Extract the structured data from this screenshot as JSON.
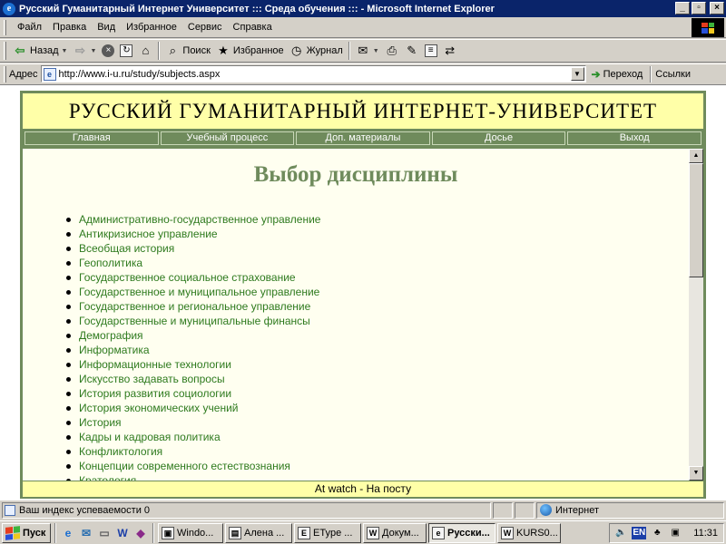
{
  "window": {
    "title": "Русский Гуманитарный Интернет Университет ::: Среда обучения ::: - Microsoft Internet Explorer",
    "buttons": {
      "minimize": "_",
      "maximize": "▫",
      "close": "×"
    }
  },
  "menu": [
    "Файл",
    "Правка",
    "Вид",
    "Избранное",
    "Сервис",
    "Справка"
  ],
  "toolbar": {
    "back_label": "Назад",
    "search_label": "Поиск",
    "favorites_label": "Избранное",
    "history_label": "Журнал"
  },
  "address": {
    "label": "Адрес",
    "url": "http://www.i-u.ru/study/subjects.aspx",
    "go_label": "Переход",
    "links_label": "Ссылки"
  },
  "site": {
    "title": "РУССКИЙ ГУМАНИТАРНЫЙ ИНТЕРНЕТ-УНИВЕРСИТЕТ",
    "nav": [
      "Главная",
      "Учебный процесс",
      "Доп. материалы",
      "Досье",
      "Выход"
    ],
    "heading": "Выбор дисциплины",
    "subjects": [
      "Административно-государственное управление",
      "Антикризисное управление",
      "Всеобщая история",
      "Геополитика",
      "Государственное социальное страхование",
      "Государственное и муниципальное управление",
      "Государственное и региональное управление",
      "Государственные и муниципальные финансы",
      "Демография",
      "Информатика",
      "Информационные технологии",
      "Искусство задавать вопросы",
      "История развития социологии",
      "История экономических учений",
      "История",
      "Кадры и кадровая политика",
      "Конфликтология",
      "Концепции современного естествознания",
      "Кратология"
    ],
    "footer": "At watch - На посту"
  },
  "status": {
    "text": "Ваш индекс успеваемости 0",
    "zone": "Интернет"
  },
  "taskbar": {
    "start_label": "Пуск",
    "tasks": [
      {
        "label": "Windo...",
        "active": false
      },
      {
        "label": "Алена ...",
        "active": false
      },
      {
        "label": "EType ...",
        "active": false
      },
      {
        "label": "Докум...",
        "active": false
      },
      {
        "label": "Русски...",
        "active": true
      },
      {
        "label": "KURS0...",
        "active": false
      }
    ],
    "lang": "EN",
    "clock": "11:31"
  },
  "colors": {
    "frame": "#6f8b5c",
    "header_bg": "#ffffa8",
    "content_bg": "#fffff0",
    "link": "#2e7a1e"
  }
}
